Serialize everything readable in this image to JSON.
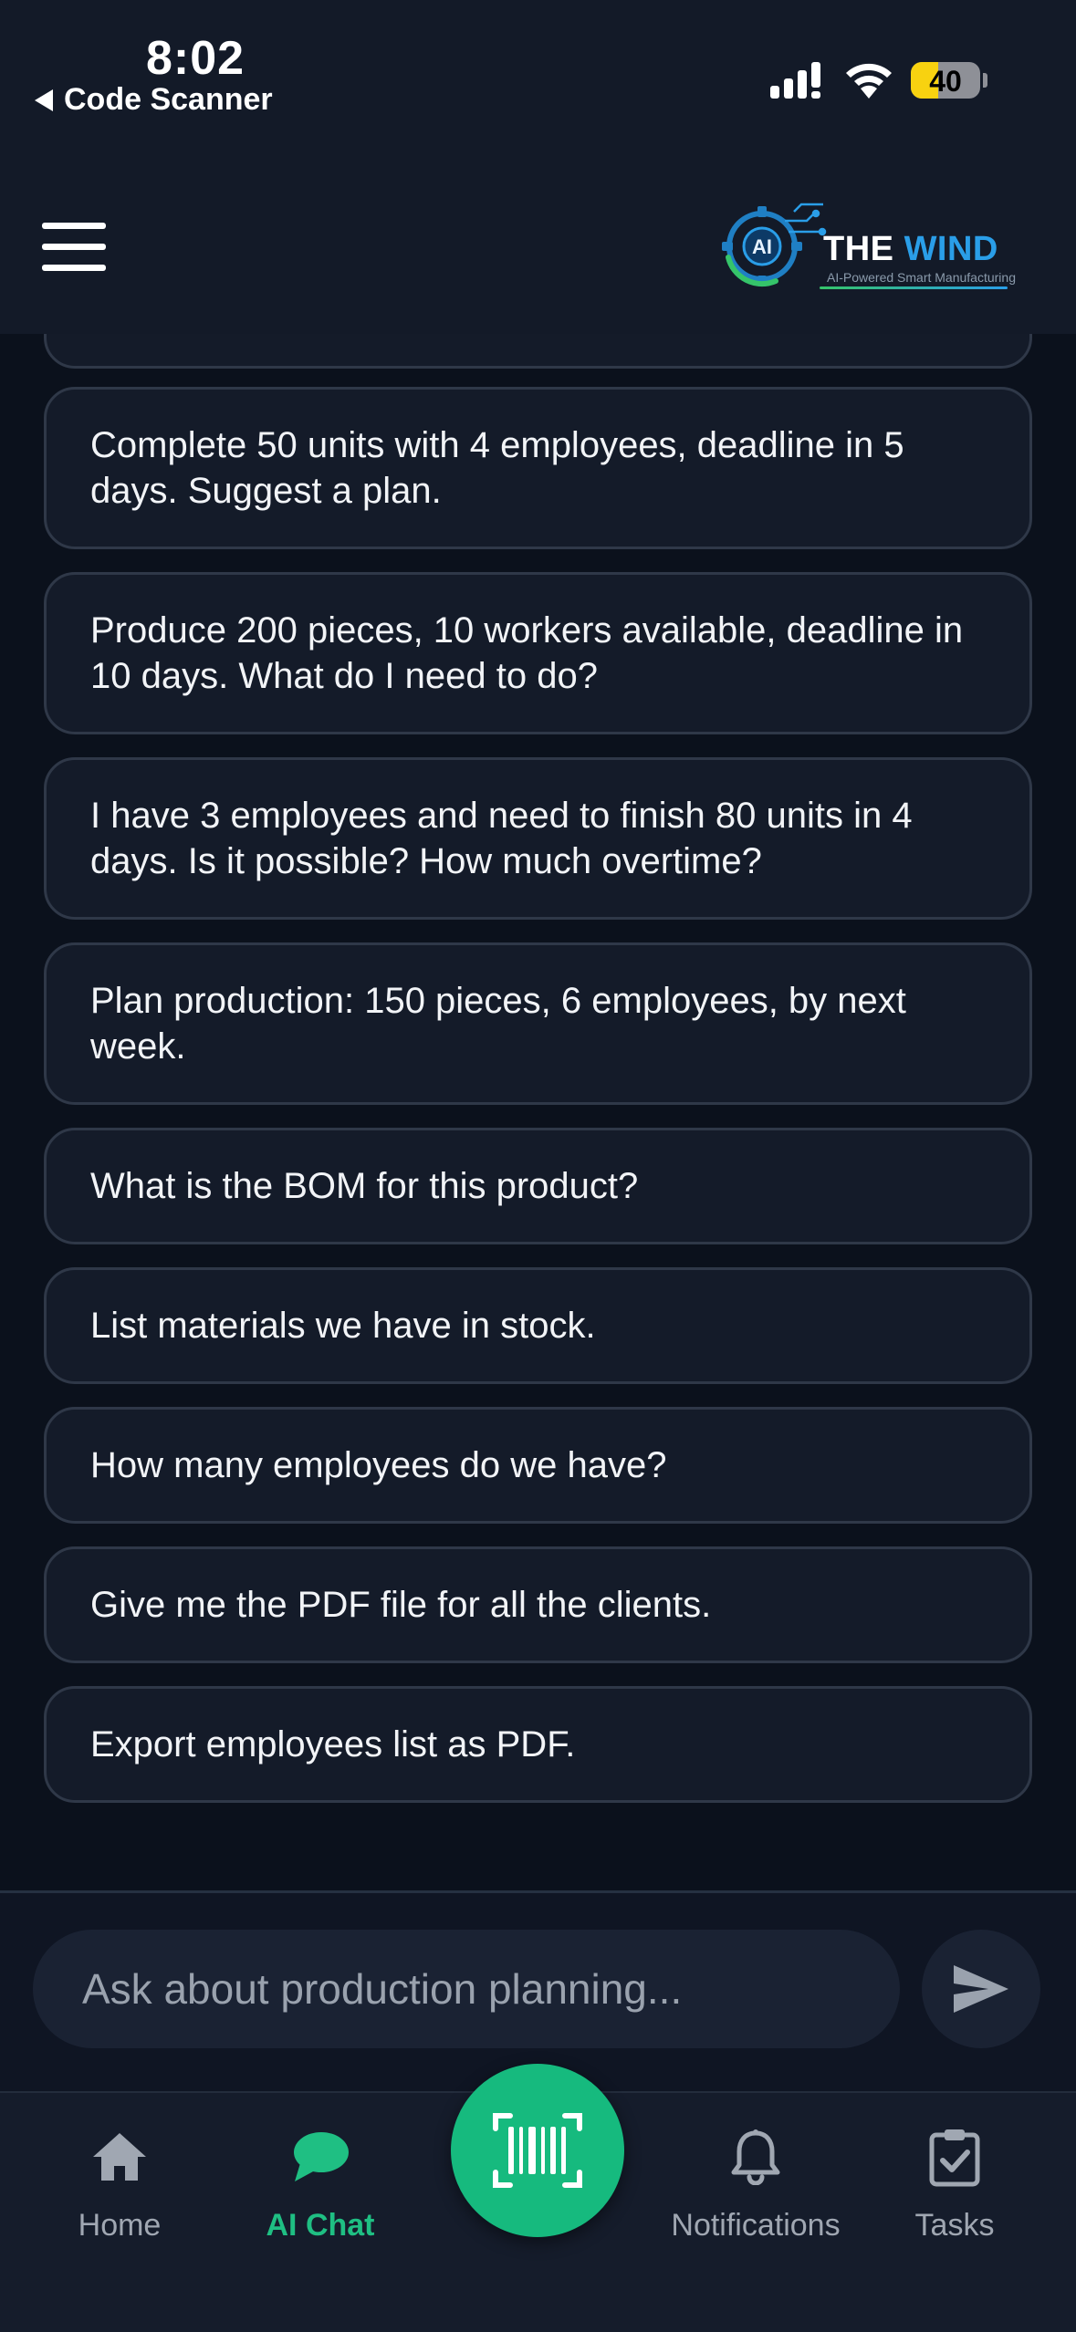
{
  "status_bar": {
    "time": "8:02",
    "back_label": "Code Scanner",
    "battery": "40",
    "battery_level": 0.4
  },
  "header": {
    "logo_title_part1": "THE ",
    "logo_title_part2": "WIND",
    "logo_badge": "AI",
    "logo_tagline": "AI-Powered Smart Manufacturing"
  },
  "suggestions": [
    "",
    "Complete 50 units with 4 employees, deadline in 5 days. Suggest a plan.",
    "Produce 200 pieces, 10 workers available, deadline in 10 days. What do I need to do?",
    "I have 3 employees and need to finish 80 units in 4 days. Is it possible? How much overtime?",
    "Plan production: 150 pieces, 6 employees, by next week.",
    "What is the BOM for this product?",
    "List materials we have in stock.",
    "How many employees do we have?",
    "Give me the PDF file for all the clients.",
    "Export employees list as PDF."
  ],
  "composer": {
    "placeholder": "Ask about production planning..."
  },
  "nav": {
    "home": "Home",
    "chat": "AI Chat",
    "notifications": "Notifications",
    "tasks": "Tasks"
  },
  "colors": {
    "accent": "#16ba7e",
    "background": "#0b111c",
    "card": "#141b29",
    "card_border": "#2f3848",
    "battery": "#f8d210"
  },
  "icons": [
    "signal-icon",
    "wifi-icon",
    "menu-icon",
    "send-icon",
    "home-icon",
    "chat-bubble-icon",
    "barcode-scan-icon",
    "bell-icon",
    "clipboard-check-icon"
  ]
}
